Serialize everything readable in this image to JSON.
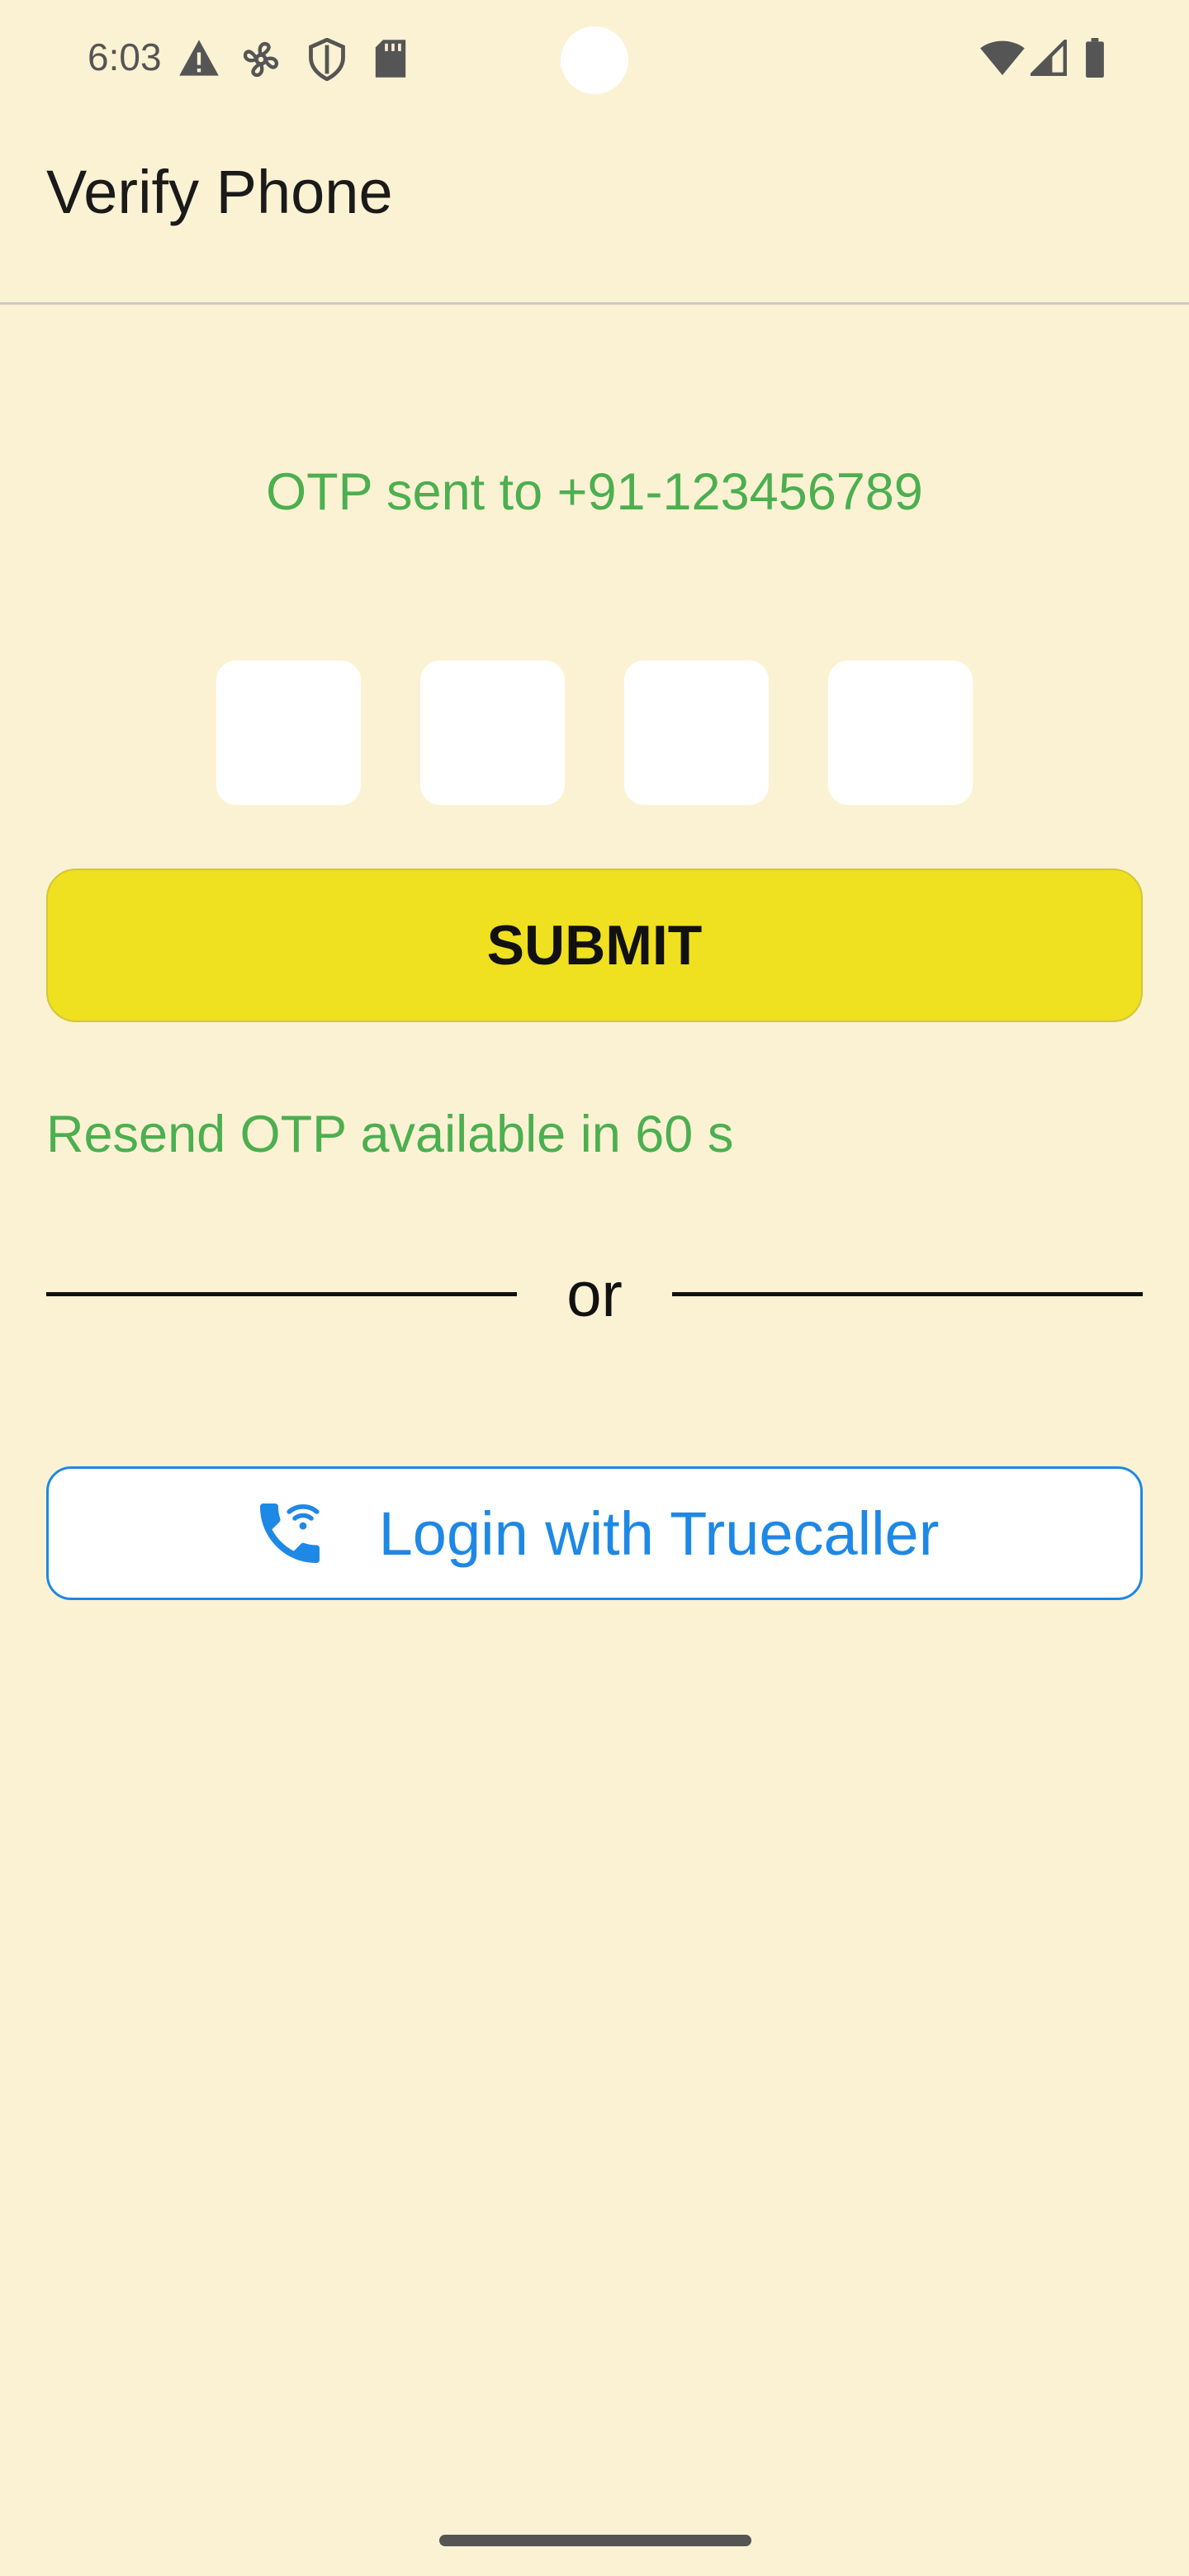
{
  "status_bar": {
    "time": "6:03",
    "icons": [
      "warning-icon",
      "fan-icon",
      "shield-icon",
      "sd-card-icon",
      "wifi-icon",
      "signal-icon",
      "battery-icon"
    ]
  },
  "app_bar": {
    "title": "Verify Phone"
  },
  "otp": {
    "sent_message": "OTP sent to +91-123456789",
    "digits": [
      "",
      "",
      "",
      ""
    ]
  },
  "submit_label": "SUBMIT",
  "resend_text": "Resend OTP available in 60 s",
  "separator_text": "or",
  "truecaller": {
    "label": "Login with Truecaller",
    "icon": "phone-wifi-icon"
  },
  "colors": {
    "background": "#FBF2D3",
    "accent_green": "#4CAF50",
    "submit_yellow": "#EFE020",
    "truecaller_blue": "#1E88E5"
  }
}
